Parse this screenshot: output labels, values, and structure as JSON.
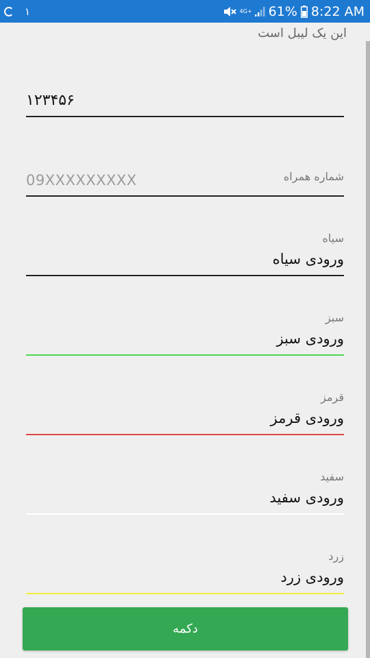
{
  "status_bar": {
    "notification_count": "١",
    "network_type": "4G+",
    "battery_percent": "61%",
    "time": "8:22 AM",
    "background_color": "#1e79d1",
    "icons": [
      "sync-icon",
      "mute-icon",
      "network-4g-icon",
      "signal-icon",
      "battery-icon"
    ]
  },
  "form": {
    "top_label": "این یک لیبل است",
    "number_field": {
      "value": "۱۲۳۴۵۶",
      "underline_color": "#222222"
    },
    "phone_field": {
      "hint": "شماره همراه",
      "placeholder": "09XXXXXXXXX",
      "underline_color": "#222222"
    },
    "black_field": {
      "hint": "سیاه",
      "value": "ورودی سیاه",
      "underline_color": "#222222"
    },
    "green_field": {
      "hint": "سبز",
      "value": "ورودی سبز",
      "underline_color": "#4cd94c"
    },
    "red_field": {
      "hint": "قرمز",
      "value": "ورودی قرمز",
      "underline_color": "#e04545"
    },
    "white_field": {
      "hint": "سفید",
      "value": "ورودی سفید",
      "underline_color": "#ffffff"
    },
    "yellow_field": {
      "hint": "زرد",
      "value": "ورودی زرد",
      "underline_color": "#f2ee3c"
    }
  },
  "button": {
    "label": "دکمه",
    "color": "#34a853"
  }
}
